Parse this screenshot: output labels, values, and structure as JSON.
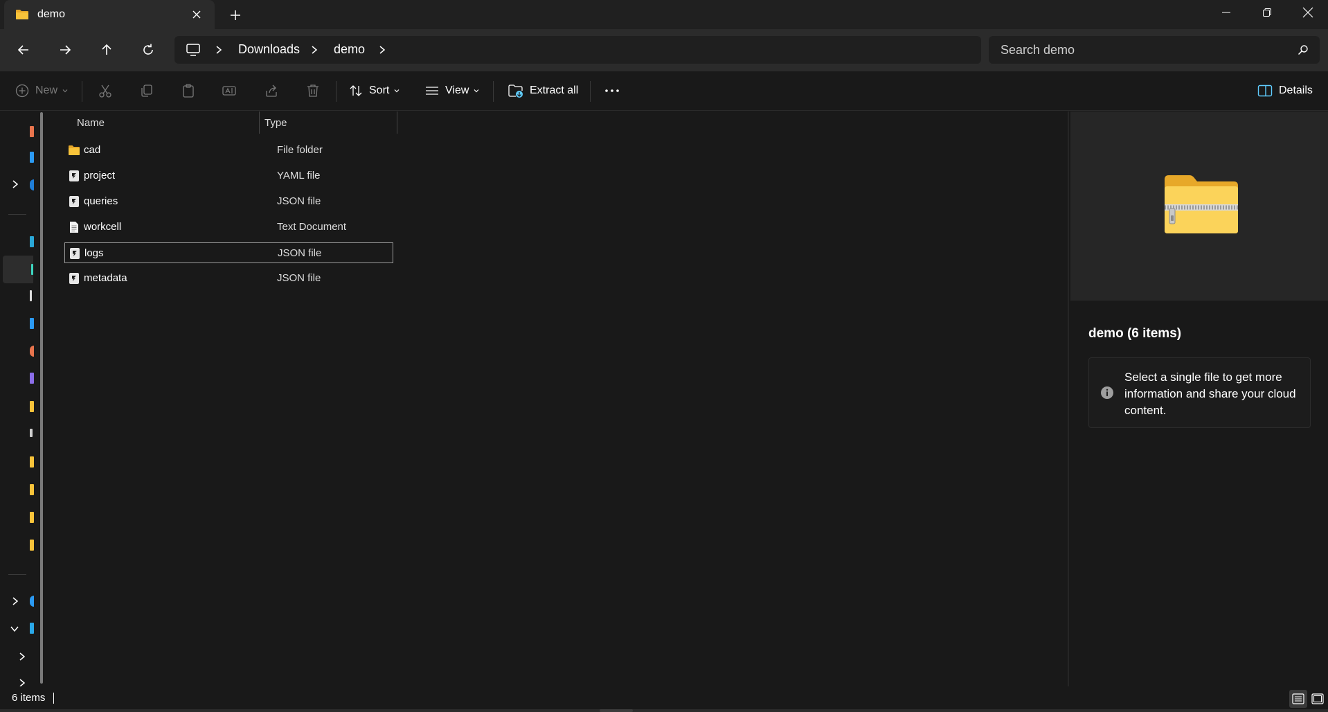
{
  "tab": {
    "title": "demo",
    "icon": "folder-icon"
  },
  "window_controls": [
    "minimize-icon",
    "restore-icon",
    "close-icon"
  ],
  "address": {
    "crumbs": [
      "Downloads",
      "demo"
    ],
    "root_icon": "this-pc-icon"
  },
  "search": {
    "placeholder": "Search demo"
  },
  "toolbar": {
    "new_label": "New",
    "sort_label": "Sort",
    "view_label": "View",
    "extract_label": "Extract all",
    "details_label": "Details"
  },
  "columns": {
    "name": "Name",
    "type": "Type"
  },
  "files": [
    {
      "name": "cad",
      "type": "File folder",
      "icon": "folder-icon"
    },
    {
      "name": "project",
      "type": "YAML file",
      "icon": "code-file-icon"
    },
    {
      "name": "queries",
      "type": "JSON file",
      "icon": "code-file-icon"
    },
    {
      "name": "workcell",
      "type": "Text Document",
      "icon": "text-document-icon"
    },
    {
      "name": "logs",
      "type": "JSON file",
      "icon": "code-file-icon",
      "selected": true
    },
    {
      "name": "metadata",
      "type": "JSON file",
      "icon": "code-file-icon"
    }
  ],
  "details_pane": {
    "title": "demo (6 items)",
    "info": "Select a single file to get more information and share your cloud content.",
    "preview_icon": "zipped-folder-icon"
  },
  "status": {
    "item_count": "6 items"
  },
  "colors": {
    "accent": "#60cdff",
    "folder_yellow": "#f8c33a",
    "background": "#191919"
  }
}
